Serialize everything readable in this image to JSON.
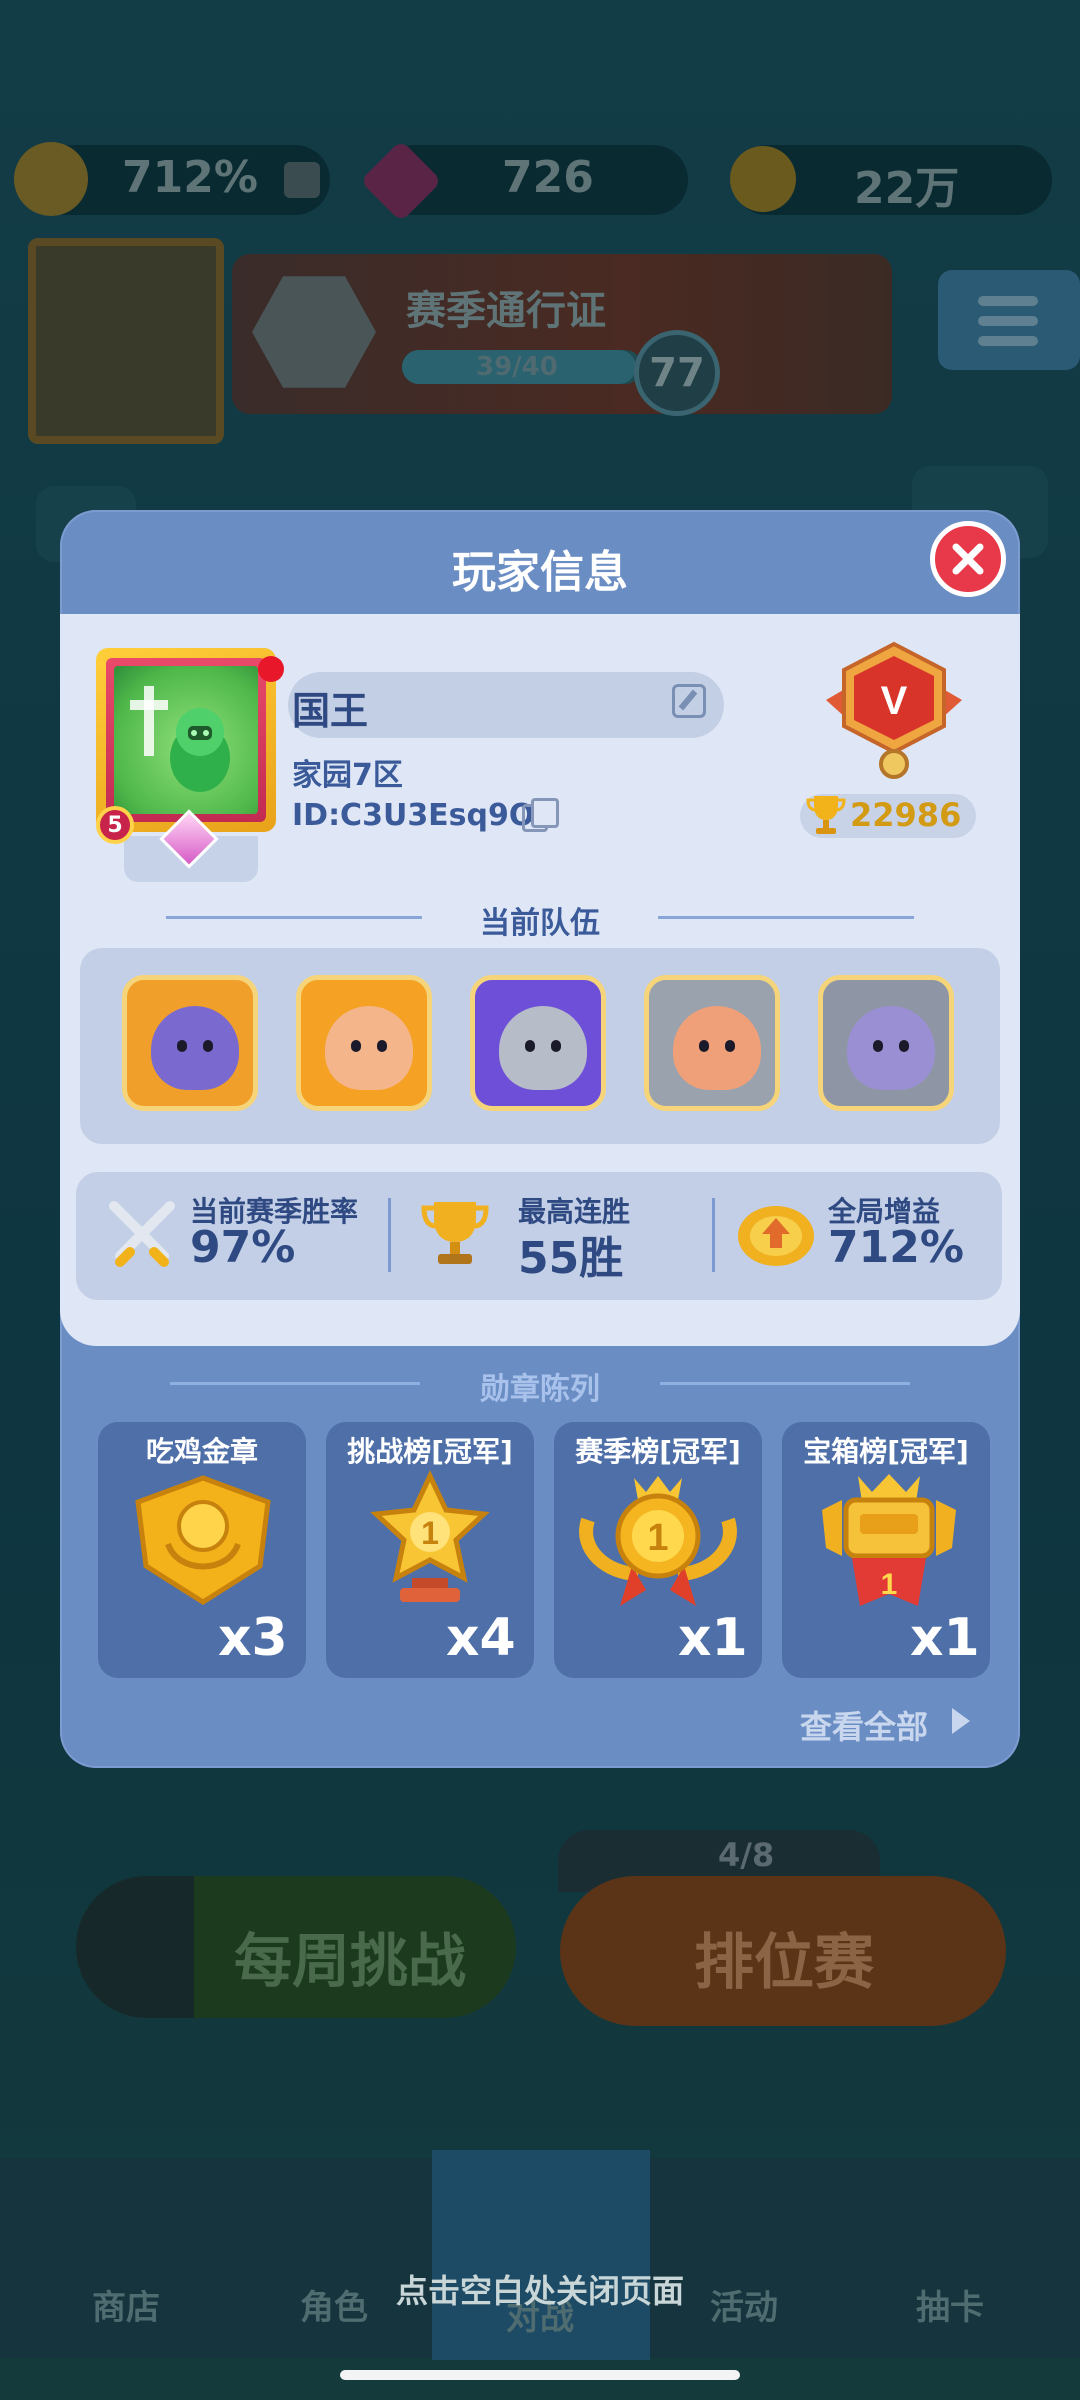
{
  "resources": {
    "boost_value": "712%",
    "gems_value": "726",
    "coins_value": "22万"
  },
  "season_pass": {
    "title": "赛季通行证",
    "progress_text": "39/40",
    "progress_fraction": 0.975,
    "level": "77"
  },
  "background": {
    "weekly_challenge_label": "每周挑战",
    "ranked_label": "排位赛",
    "ranked_progress": "4/8",
    "nav": [
      "商店",
      "角色",
      "对战",
      "活动",
      "抽卡"
    ]
  },
  "modal": {
    "title": "玩家信息",
    "player": {
      "name": "国王",
      "home": "家园7区",
      "id": "ID:C3U3Esq9O2",
      "avatar_level": "5",
      "rank_letter": "V",
      "trophies": "22986"
    },
    "team_title": "当前队伍",
    "team": [
      {
        "name": "hero-dark-knight",
        "bg": "#f0a02a",
        "face": "#7a6ad0"
      },
      {
        "name": "hero-king-warrior",
        "bg": "#f5a124",
        "face": "#f4b58a"
      },
      {
        "name": "hero-armored-knight",
        "bg": "#6e4fd8",
        "face": "#b6bcc8"
      },
      {
        "name": "hero-barbarian",
        "bg": "#9aa2ad",
        "face": "#f0a078"
      },
      {
        "name": "hero-ghost-assassin",
        "bg": "#8e96a6",
        "face": "#9a8fd2"
      }
    ],
    "stats": [
      {
        "label": "当前赛季胜率",
        "value": "97%",
        "icon": "crossed-swords-icon"
      },
      {
        "label": "最高连胜",
        "value": "55胜",
        "icon": "trophy-icon"
      },
      {
        "label": "全局增益",
        "value": "712%",
        "icon": "boost-icon"
      }
    ],
    "medals_title": "勋章陈列",
    "medals": [
      {
        "label": "吃鸡金章",
        "count": "x3",
        "icon": "gold-badge-icon"
      },
      {
        "label": "挑战榜[冠军]",
        "count": "x4",
        "icon": "star-trophy-icon"
      },
      {
        "label": "赛季榜[冠军]",
        "count": "x1",
        "icon": "laurel-medal-icon"
      },
      {
        "label": "宝箱榜[冠军]",
        "count": "x1",
        "icon": "chest-crown-icon"
      }
    ],
    "view_all": "查看全部"
  },
  "close_hint": "点击空白处关闭页面",
  "colors": {
    "modal_header": "#6a8dc4",
    "panel": "#dfe7f6",
    "text_primary": "#2f4a82",
    "close_red": "#e8394a",
    "gold": "#d39a14"
  }
}
